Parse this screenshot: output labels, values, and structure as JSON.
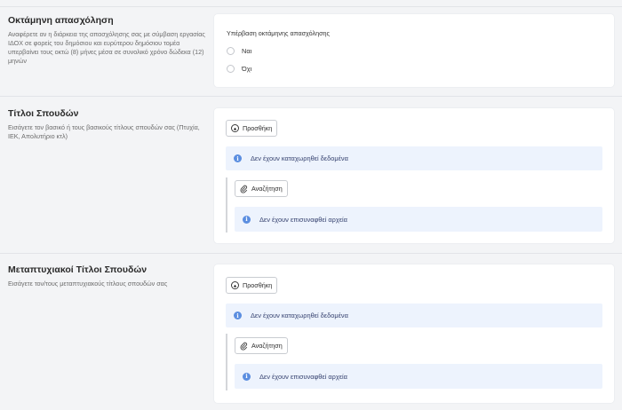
{
  "sections": {
    "overtime": {
      "title": "Οκτάμηνη απασχόληση",
      "desc": "Αναφέρετε αν η διάρκεια της απασχόλησης σας με σύμβαση εργασίας ΙΔΟΧ σε φορείς του δημόσιου και ευρύτερου δημόσιου τομέα υπερβαίνει τους οκτώ (8) μήνες μέσα σε συνολικό χρόνο δώδεκα (12) μηνών",
      "field_label": "Υπέρβαση οκτάμηνης απασχόλησης",
      "options": [
        "Ναι",
        "Όχι"
      ]
    },
    "degrees": {
      "title": "Τίτλοι Σπουδών",
      "desc": "Εισάγετε τον βασικό ή τους βασικούς τίτλους σπουδών σας (Πτυχία, ΙΕΚ, Απολυτήριο κτλ)",
      "add_label": "Προσθήκη",
      "no_data": "Δεν έχουν καταχωρηθεί δεδομένα",
      "search_label": "Αναζήτηση",
      "no_files": "Δεν έχουν επισυναφθεί αρχεία"
    },
    "postgrad": {
      "title": "Μεταπτυχιακοί Τίτλοι Σπουδών",
      "desc": "Εισάγετε τον/τους μεταπτυχιακούς τίτλους σπουδών σας",
      "add_label": "Προσθήκη",
      "no_data": "Δεν έχουν καταχωρηθεί δεδομένα",
      "search_label": "Αναζήτηση",
      "no_files": "Δεν έχουν επισυναφθεί αρχεία"
    }
  },
  "colors": {
    "background": "#f3f4f6",
    "card": "#ffffff",
    "info_bg": "#edf3fd",
    "info_icon": "#5b8ee0",
    "info_text": "#34406e"
  },
  "icons": {
    "info": "info-circle-icon",
    "add": "plus-circle-icon",
    "attach": "paperclip-icon"
  }
}
